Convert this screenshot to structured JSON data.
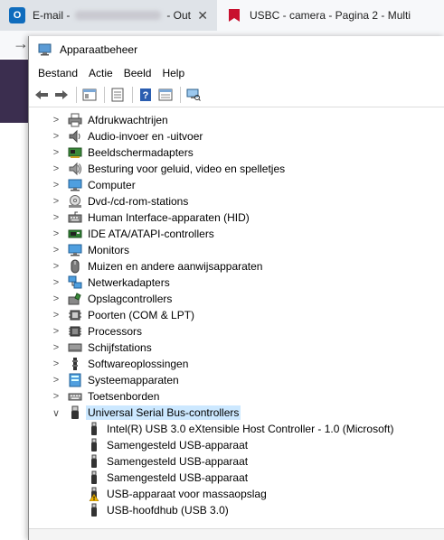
{
  "browser": {
    "tabs": [
      {
        "title_start": "E-mail - ",
        "title_end": "- Out"
      },
      {
        "title": "USBC - camera - Pagina 2 - Multi"
      }
    ]
  },
  "window": {
    "title": "Apparaatbeheer",
    "menu": [
      "Bestand",
      "Actie",
      "Beeld",
      "Help"
    ]
  },
  "tree": {
    "categories": [
      {
        "label": "Afdrukwachtrijen",
        "icon": "printer-icon"
      },
      {
        "label": "Audio-invoer en -uitvoer",
        "icon": "speaker-icon"
      },
      {
        "label": "Beeldschermadapters",
        "icon": "display-adapter-icon"
      },
      {
        "label": "Besturing voor geluid, video en spelletjes",
        "icon": "sound-icon"
      },
      {
        "label": "Computer",
        "icon": "computer-icon"
      },
      {
        "label": "Dvd-/cd-rom-stations",
        "icon": "disc-icon"
      },
      {
        "label": "Human Interface-apparaten (HID)",
        "icon": "hid-icon"
      },
      {
        "label": "IDE ATA/ATAPI-controllers",
        "icon": "ide-icon"
      },
      {
        "label": "Monitors",
        "icon": "monitor-icon"
      },
      {
        "label": "Muizen en andere aanwijsapparaten",
        "icon": "mouse-icon"
      },
      {
        "label": "Netwerkadapters",
        "icon": "network-icon"
      },
      {
        "label": "Opslagcontrollers",
        "icon": "storage-icon"
      },
      {
        "label": "Poorten (COM & LPT)",
        "icon": "port-icon"
      },
      {
        "label": "Processors",
        "icon": "processor-icon"
      },
      {
        "label": "Schijfstations",
        "icon": "disk-icon"
      },
      {
        "label": "Softwareoplossingen",
        "icon": "software-icon"
      },
      {
        "label": "Systeemapparaten",
        "icon": "system-icon"
      },
      {
        "label": "Toetsenborden",
        "icon": "keyboard-icon"
      },
      {
        "label": "Universal Serial Bus-controllers",
        "icon": "usb-icon",
        "expanded": true,
        "selected": true
      }
    ],
    "usb_children": [
      {
        "label": "Intel(R) USB 3.0 eXtensible Host Controller - 1.0 (Microsoft)",
        "warning": false
      },
      {
        "label": "Samengesteld USB-apparaat",
        "warning": false
      },
      {
        "label": "Samengesteld USB-apparaat",
        "warning": false
      },
      {
        "label": "Samengesteld USB-apparaat",
        "warning": false
      },
      {
        "label": "USB-apparaat voor massaopslag",
        "warning": true
      },
      {
        "label": "USB-hoofdhub (USB 3.0)",
        "warning": false
      }
    ]
  },
  "colors": {
    "selection": "#cce8ff",
    "accent_blue": "#1e73be",
    "warning": "#f2b600"
  }
}
